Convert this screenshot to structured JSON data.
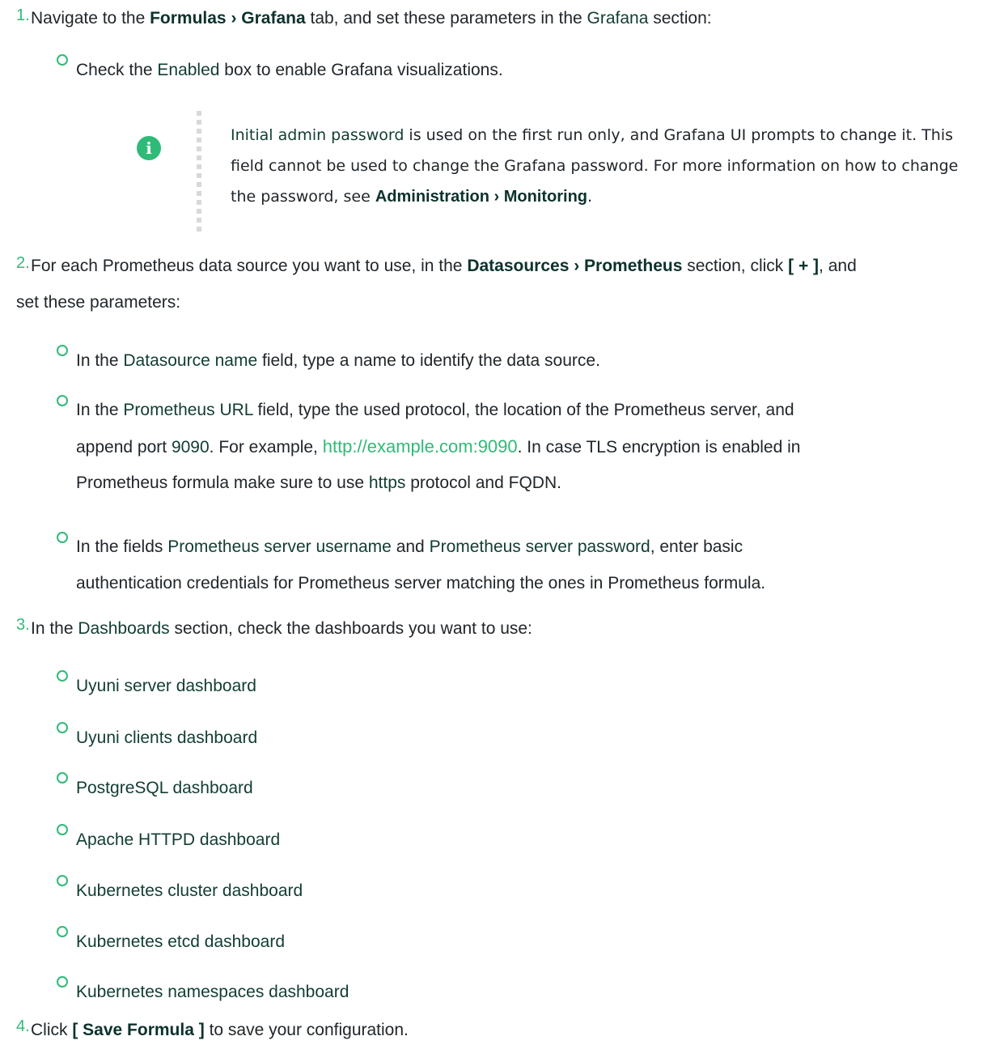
{
  "steps": [
    {
      "num": "1.",
      "parts": [
        "Navigate to the ",
        "Formulas › Grafana",
        " tab, and set these parameters in the ",
        "Grafana",
        " section:"
      ],
      "sub": [
        {
          "parts": [
            "Check the ",
            "Enabled",
            " box to enable Grafana visualizations."
          ]
        }
      ],
      "note": {
        "parts": [
          "Initial admin password",
          " is used on the first run only, and Grafana UI prompts to change it. This field cannot be used to change the Grafana password. For more information on how to change the password, see ",
          "Administration › Monitoring",
          "."
        ]
      }
    },
    {
      "num": "2.",
      "parts": [
        "For each Prometheus data source you want to use, in the ",
        "Datasources › Prometheus",
        " section, click ",
        "[ + ]",
        ", and",
        "set these parameters:"
      ],
      "sub": [
        {
          "parts": [
            "In the ",
            "Datasource name",
            " field, type a name to identify the data source."
          ]
        },
        {
          "parts": [
            "In the ",
            "Prometheus URL",
            " field, type the used protocol, the location of the Prometheus server, and",
            "append port ",
            "9090",
            ". For example, ",
            "http://example.com:9090",
            ". In case TLS encryption is enabled in",
            "Prometheus formula make sure to use ",
            "https",
            " protocol and FQDN."
          ]
        },
        {
          "parts": [
            "In the fields ",
            "Prometheus server username",
            " and ",
            "Prometheus server password",
            ", enter basic",
            "authentication credentials for Prometheus server matching the ones in Prometheus formula."
          ]
        }
      ]
    },
    {
      "num": "3.",
      "parts": [
        "In the ",
        "Dashboards",
        " section, check the dashboards you want to use:"
      ],
      "sub": [
        {
          "parts": [
            "Uyuni server dashboard"
          ]
        },
        {
          "parts": [
            "Uyuni clients dashboard"
          ]
        },
        {
          "parts": [
            "PostgreSQL dashboard"
          ]
        },
        {
          "parts": [
            "Apache HTTPD dashboard"
          ]
        },
        {
          "parts": [
            "Kubernetes cluster dashboard"
          ]
        },
        {
          "parts": [
            "Kubernetes etcd dashboard"
          ]
        },
        {
          "parts": [
            "Kubernetes namespaces dashboard"
          ]
        }
      ]
    },
    {
      "num": "4.",
      "parts": [
        "Click ",
        "[ Save Formula ]",
        " to save your configuration."
      ]
    }
  ],
  "colors": {
    "accent": "#30ba78",
    "ui_term": "#0c322c",
    "text": "#20262b"
  },
  "icons": {
    "note": "info-icon",
    "bullet": "circle-bullet-icon"
  }
}
